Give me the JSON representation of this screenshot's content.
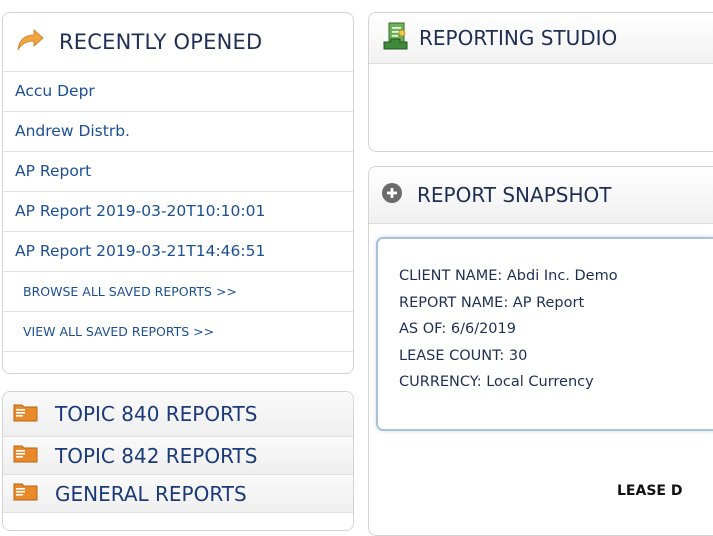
{
  "recently_opened": {
    "title": "RECENTLY OPENED",
    "items": [
      "Accu Depr",
      "Andrew Distrb.",
      "AP Report",
      "AP Report 2019-03-20T10:10:01",
      "AP Report 2019-03-21T14:46:51"
    ],
    "browse_all": "BROWSE ALL SAVED REPORTS >>",
    "view_all": "VIEW ALL SAVED REPORTS >>"
  },
  "topics": [
    "TOPIC 840 REPORTS",
    "TOPIC 842 REPORTS",
    "GENERAL REPORTS"
  ],
  "reporting_studio": {
    "title": "REPORTING STUDIO"
  },
  "report_snapshot": {
    "title": "REPORT SNAPSHOT",
    "client_name": "CLIENT NAME: Abdi Inc. Demo",
    "report_name": "REPORT NAME: AP Report",
    "as_of": "AS OF: 6/6/2019",
    "lease_count": "LEASE COUNT: 30",
    "currency": "CURRENCY: Local Currency",
    "lease_label": "LEASE D"
  },
  "colors": {
    "link": "#1a4f94",
    "heading": "#1f2f54",
    "folder_icon": "#e98a2a",
    "arrow_icon": "#f0a640",
    "studio_icon": "#3e8a3a",
    "card_border": "#a9c2d8"
  }
}
